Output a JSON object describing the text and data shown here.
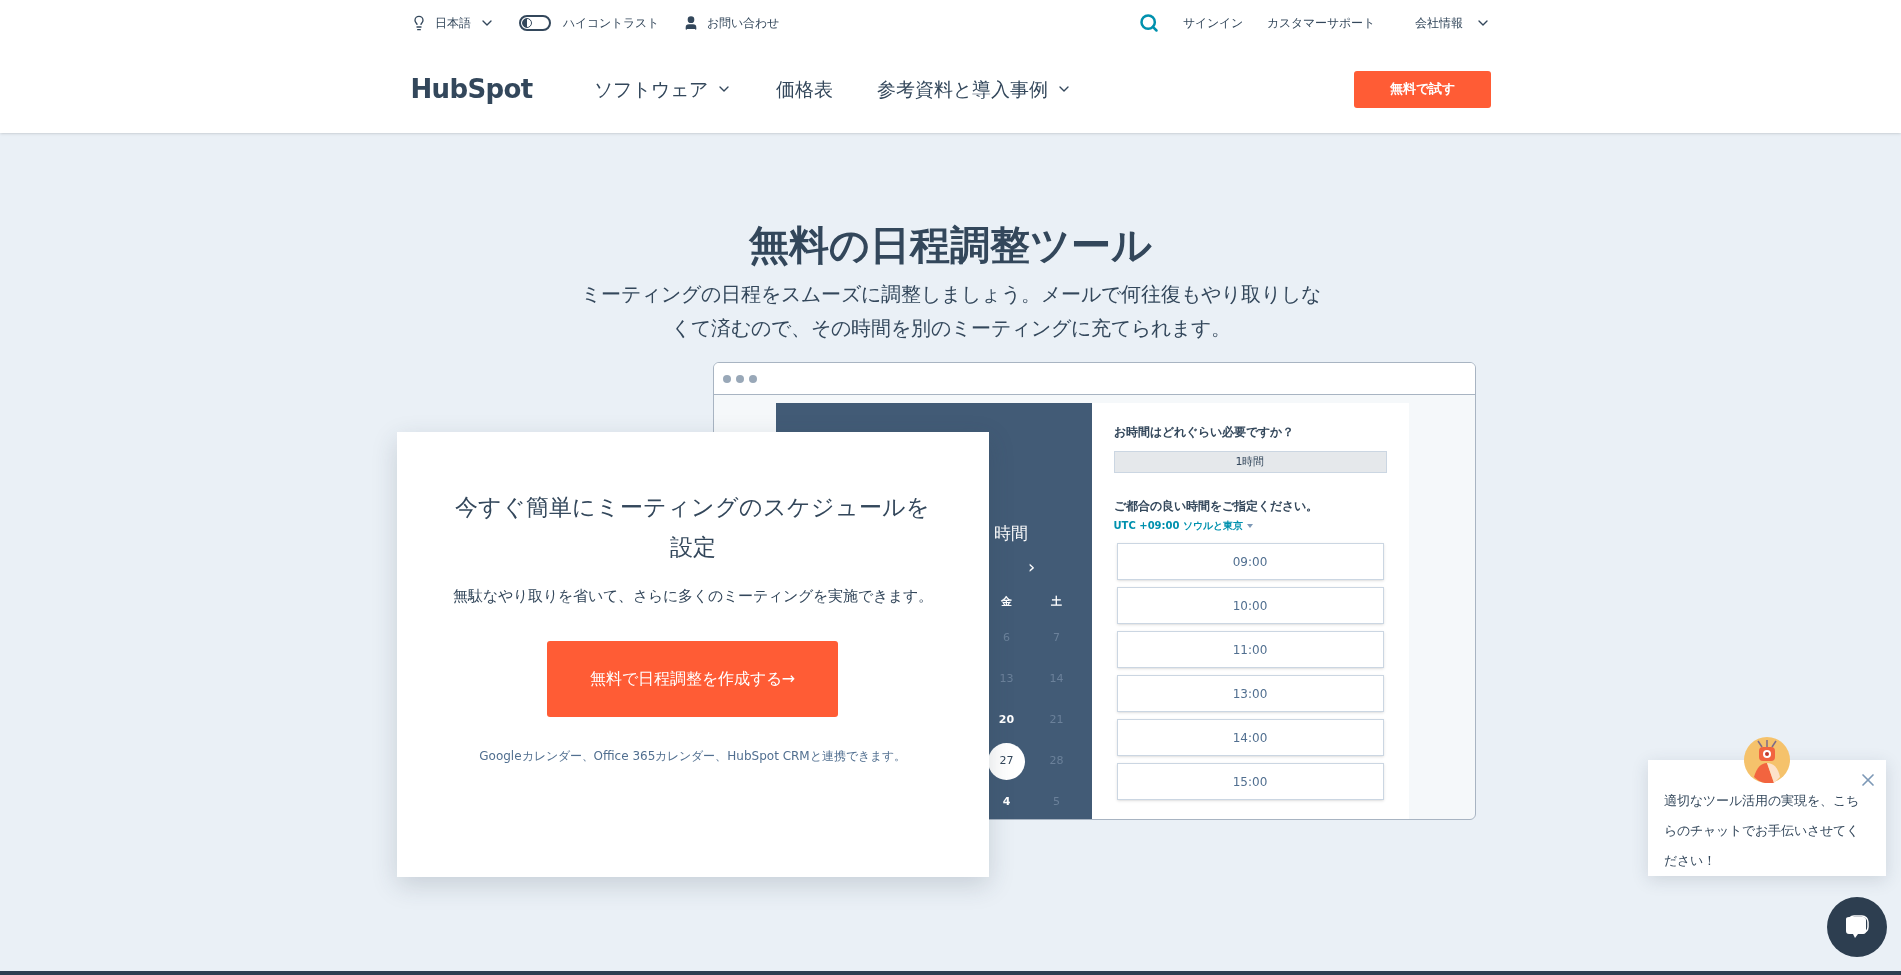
{
  "top_bar": {
    "language": "日本語",
    "high_contrast": {
      "label": "ハイコントラスト",
      "on": false
    },
    "contact": "お問い合わせ",
    "sign_in": "サインイン",
    "support": "カスタマーサポート",
    "company": "会社情報"
  },
  "nav": {
    "logo": "HubSpot",
    "items": [
      {
        "label": "ソフトウェア",
        "dropdown": true
      },
      {
        "label": "価格表",
        "dropdown": false
      },
      {
        "label": "参考資料と導入事例",
        "dropdown": true
      }
    ],
    "cta": "無料で試す"
  },
  "hero": {
    "title": "無料の日程調整ツール",
    "subtitle": "ミーティングの日程をスムーズに調整しましょう。メールで何往復もやり取りしなくて済むので、その時間を別のミーティングに充てられます。"
  },
  "mockup": {
    "calendar": {
      "heading": "時間",
      "next": "›",
      "weekdays": [
        "金",
        "土"
      ],
      "days": [
        {
          "label": "6",
          "disabled": true,
          "selected": false
        },
        {
          "label": "7",
          "disabled": true,
          "selected": false
        },
        {
          "label": "13",
          "disabled": true,
          "selected": false
        },
        {
          "label": "14",
          "disabled": true,
          "selected": false
        },
        {
          "label": "20",
          "disabled": false,
          "selected": false
        },
        {
          "label": "21",
          "disabled": true,
          "selected": false
        },
        {
          "label": "27",
          "disabled": false,
          "selected": true
        },
        {
          "label": "28",
          "disabled": true,
          "selected": false
        },
        {
          "label": "4",
          "disabled": false,
          "selected": false
        },
        {
          "label": "5",
          "disabled": true,
          "selected": false
        }
      ]
    },
    "duration_question": "お時間はどれぐらい必要ですか？",
    "duration": "1時間",
    "time_question": "ご都合の良い時間をご指定ください。",
    "timezone": "UTC +09:00 ソウルと東京",
    "slots": [
      "09:00",
      "10:00",
      "11:00",
      "13:00",
      "14:00",
      "15:00"
    ]
  },
  "card": {
    "title": "今すぐ簡単にミーティングのスケジュールを設定",
    "text": "無駄なやり取りを省いて、さらに多くのミーティングを実施できます。",
    "button": "無料で日程調整を作成する→",
    "note": "Googleカレンダー、Office 365カレンダー、HubSpot CRMと連携できます。"
  },
  "chat": {
    "message": "適切なツール活用の実現を、こちらのチャットでお手伝いさせてください！"
  }
}
